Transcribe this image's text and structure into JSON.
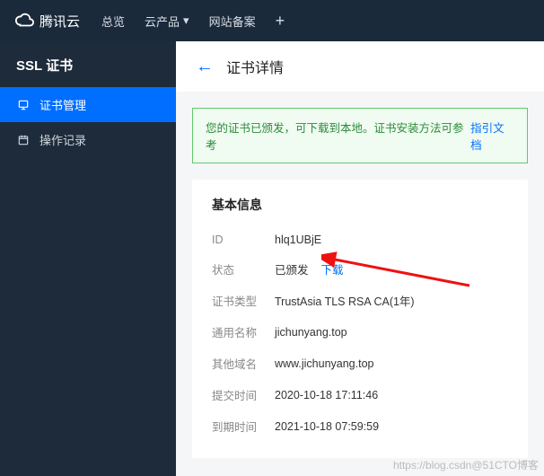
{
  "topbar": {
    "brand": "腾讯云",
    "nav": {
      "overview": "总览",
      "products": "云产品",
      "beian": "网站备案"
    }
  },
  "sidebar": {
    "title": "SSL 证书",
    "items": [
      {
        "label": "证书管理"
      },
      {
        "label": "操作记录"
      }
    ]
  },
  "page": {
    "title": "证书详情"
  },
  "alert": {
    "prefix": "您的证书已颁发，可下载到本地。证书安装方法可参考",
    "link": "指引文档"
  },
  "info": {
    "section_title": "基本信息",
    "labels": {
      "id": "ID",
      "status": "状态",
      "type": "证书类型",
      "cn": "通用名称",
      "other": "其他域名",
      "submitted": "提交时间",
      "expires": "到期时间"
    },
    "values": {
      "id": "hlq1UBjE",
      "status": "已颁发",
      "download": "下载",
      "type": "TrustAsia TLS RSA CA(1年)",
      "cn": "jichunyang.top",
      "other": "www.jichunyang.top",
      "submitted": "2020-10-18 17:11:46",
      "expires": "2021-10-18 07:59:59"
    }
  },
  "watermark": "https://blog.csdn@51CTO博客"
}
